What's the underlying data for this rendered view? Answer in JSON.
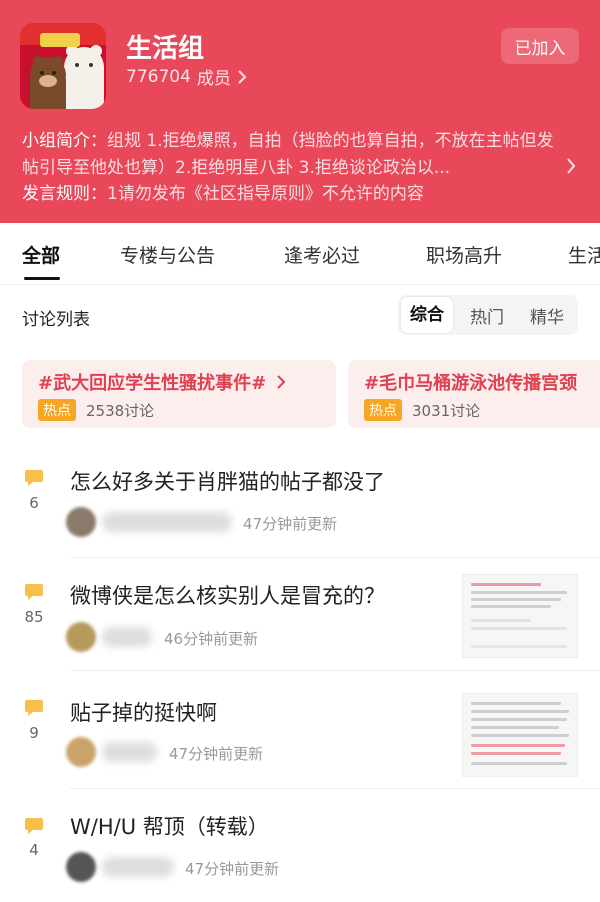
{
  "header": {
    "title": "生活组",
    "member_count": "776704",
    "member_suffix": "成员",
    "join_label": "已加入",
    "intro_label": "小组简介：",
    "intro_text": "组规 1.拒绝爆照，自拍（挡脸的也算自拍，不放在主帖但发帖引导至他处也算）2.拒绝明星八卦 3.拒绝谈论政治以...",
    "rules_label": "发言规则：",
    "rules_text": "1请勿发布《社区指导原则》不允许的内容",
    "brand_color": "#e9485a"
  },
  "tabs": [
    {
      "label": "全部",
      "active": true
    },
    {
      "label": "专楼与公告"
    },
    {
      "label": "逢考必过"
    },
    {
      "label": "职场高升"
    },
    {
      "label": "生活"
    }
  ],
  "discussion": {
    "title": "讨论列表",
    "sort_options": [
      "综合",
      "热门",
      "精华"
    ],
    "active_sort": "综合"
  },
  "hot_topics": [
    {
      "topic": "#武大回应学生性骚扰事件#",
      "badge": "热点",
      "count": "2538讨论"
    },
    {
      "topic": "#毛巾马桶游泳池传播宫颈",
      "badge": "热点",
      "count": "3031讨论"
    }
  ],
  "posts": [
    {
      "title": "怎么好多关于肖胖猫的帖子都没了",
      "comments": "6",
      "time": "47分钟前更新"
    },
    {
      "title": "微博侠是怎么核实别人是冒充的？",
      "comments": "85",
      "time": "46分钟前更新"
    },
    {
      "title": "贴子掉的挺快啊",
      "comments": "9",
      "time": "47分钟前更新"
    },
    {
      "title": "W/H/U 帮顶（转载）",
      "comments": "4",
      "time": "47分钟前更新"
    }
  ],
  "icons": {
    "member_chevron": "chevron-right-icon",
    "intro_chevron": "chevron-right-icon",
    "comment": "comment-bubble-icon"
  },
  "colors": {
    "accent": "#e9485a",
    "hot_badge": "#f6a623",
    "comment_icon": "#f7c04a",
    "hot_topic_text": "#e04050"
  }
}
